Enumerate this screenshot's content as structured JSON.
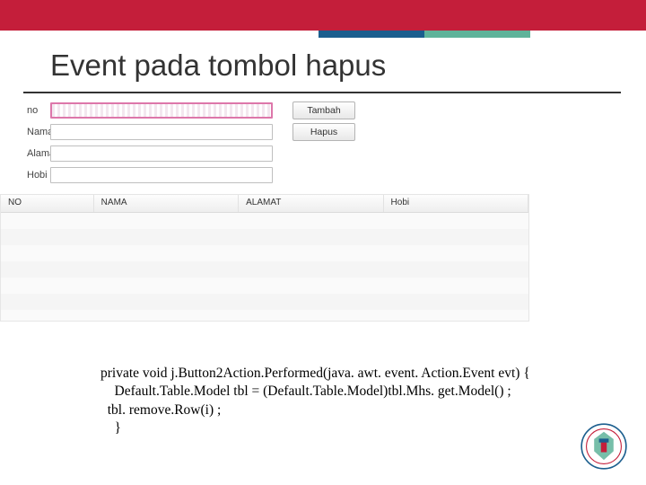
{
  "title": "Event pada tombol hapus",
  "form": {
    "rows": [
      {
        "label": "no",
        "button": "Tambah"
      },
      {
        "label": "Nama",
        "button": "Hapus"
      },
      {
        "label": "Alamat",
        "button": ""
      },
      {
        "label": "Hobi",
        "button": ""
      }
    ]
  },
  "table": {
    "headers": [
      "NO",
      "NAMA",
      "ALAMAT",
      "Hobi"
    ]
  },
  "code": {
    "l1": "private void j.Button2Action.Performed(java. awt. event. Action.Event evt) {",
    "l2": "    Default.Table.Model tbl = (Default.Table.Model)tbl.Mhs. get.Model() ;",
    "l3": "  tbl. remove.Row(i) ;",
    "l4": "    }"
  }
}
